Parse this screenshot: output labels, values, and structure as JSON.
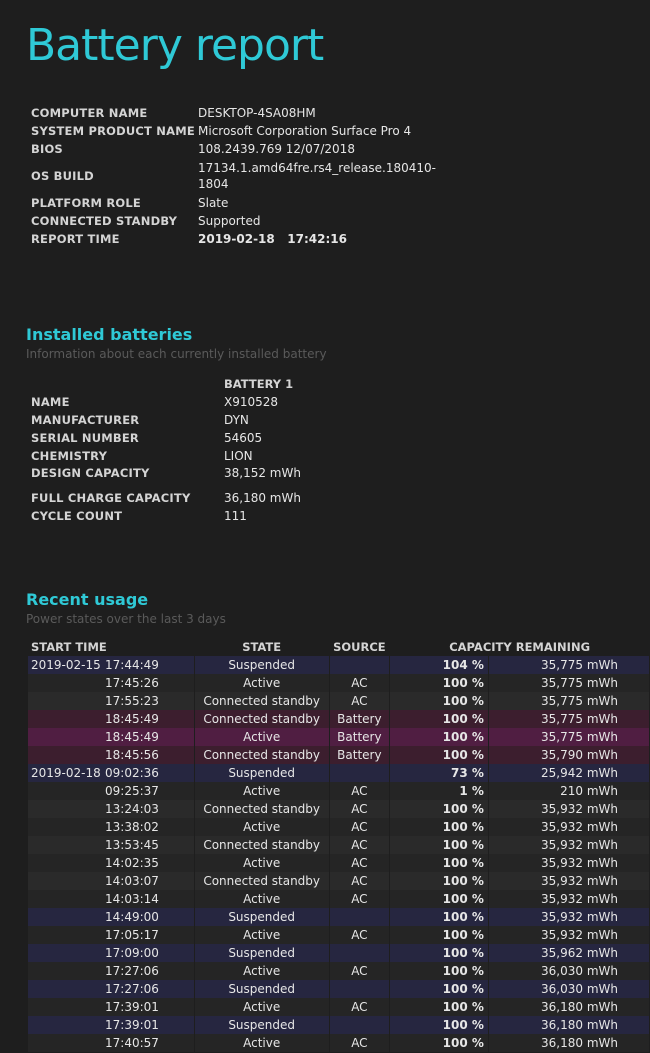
{
  "title": "Battery report",
  "system_info": [
    {
      "label": "COMPUTER NAME",
      "value": "DESKTOP-4SA08HM"
    },
    {
      "label": "SYSTEM PRODUCT NAME",
      "value": "Microsoft Corporation Surface Pro 4"
    },
    {
      "label": "BIOS",
      "value": "108.2439.769 12/07/2018"
    },
    {
      "label": "OS BUILD",
      "value_line1": "17134.1.amd64fre.rs4_release.180410-",
      "value_line2": "1804"
    },
    {
      "label": "PLATFORM ROLE",
      "value": "Slate"
    },
    {
      "label": "CONNECTED STANDBY",
      "value": "Supported"
    },
    {
      "label": "REPORT TIME",
      "value": "2019-02-18   17:42:16"
    }
  ],
  "installed_batteries": {
    "title": "Installed batteries",
    "subtitle": "Information about each currently installed battery",
    "column_header": "BATTERY 1",
    "rows": [
      {
        "label": "NAME",
        "value": "X910528"
      },
      {
        "label": "MANUFACTURER",
        "value": "DYN"
      },
      {
        "label": "SERIAL NUMBER",
        "value": "54605"
      },
      {
        "label": "CHEMISTRY",
        "value": "LION"
      },
      {
        "label": "DESIGN CAPACITY",
        "value": "38,152 mWh"
      },
      {
        "label": "FULL CHARGE CAPACITY",
        "value": "36,180 mWh"
      },
      {
        "label": "CYCLE COUNT",
        "value": "111"
      }
    ]
  },
  "recent_usage": {
    "title": "Recent usage",
    "subtitle": "Power states over the last 3 days",
    "headers": {
      "start_time": "START TIME",
      "state": "STATE",
      "source": "SOURCE",
      "capacity": "CAPACITY REMAINING"
    },
    "rows": [
      {
        "date": "2019-02-15",
        "time": "17:44:49",
        "state": "Suspended",
        "source": "",
        "pct": "104 %",
        "mwh": "35,775 mWh"
      },
      {
        "date": "",
        "time": "17:45:26",
        "state": "Active",
        "source": "AC",
        "pct": "100 %",
        "mwh": "35,775 mWh"
      },
      {
        "date": "",
        "time": "17:55:23",
        "state": "Connected standby",
        "source": "AC",
        "pct": "100 %",
        "mwh": "35,775 mWh"
      },
      {
        "date": "",
        "time": "18:45:49",
        "state": "Connected standby",
        "source": "Battery",
        "pct": "100 %",
        "mwh": "35,775 mWh"
      },
      {
        "date": "",
        "time": "18:45:49",
        "state": "Active",
        "source": "Battery",
        "pct": "100 %",
        "mwh": "35,775 mWh"
      },
      {
        "date": "",
        "time": "18:45:56",
        "state": "Connected standby",
        "source": "Battery",
        "pct": "100 %",
        "mwh": "35,790 mWh"
      },
      {
        "date": "2019-02-18",
        "time": "09:02:36",
        "state": "Suspended",
        "source": "",
        "pct": "73 %",
        "mwh": "25,942 mWh"
      },
      {
        "date": "",
        "time": "09:25:37",
        "state": "Active",
        "source": "AC",
        "pct": "1 %",
        "mwh": "210 mWh"
      },
      {
        "date": "",
        "time": "13:24:03",
        "state": "Connected standby",
        "source": "AC",
        "pct": "100 %",
        "mwh": "35,932 mWh"
      },
      {
        "date": "",
        "time": "13:38:02",
        "state": "Active",
        "source": "AC",
        "pct": "100 %",
        "mwh": "35,932 mWh"
      },
      {
        "date": "",
        "time": "13:53:45",
        "state": "Connected standby",
        "source": "AC",
        "pct": "100 %",
        "mwh": "35,932 mWh"
      },
      {
        "date": "",
        "time": "14:02:35",
        "state": "Active",
        "source": "AC",
        "pct": "100 %",
        "mwh": "35,932 mWh"
      },
      {
        "date": "",
        "time": "14:03:07",
        "state": "Connected standby",
        "source": "AC",
        "pct": "100 %",
        "mwh": "35,932 mWh"
      },
      {
        "date": "",
        "time": "14:03:14",
        "state": "Active",
        "source": "AC",
        "pct": "100 %",
        "mwh": "35,932 mWh"
      },
      {
        "date": "",
        "time": "14:49:00",
        "state": "Suspended",
        "source": "",
        "pct": "100 %",
        "mwh": "35,932 mWh"
      },
      {
        "date": "",
        "time": "17:05:17",
        "state": "Active",
        "source": "AC",
        "pct": "100 %",
        "mwh": "35,932 mWh"
      },
      {
        "date": "",
        "time": "17:09:00",
        "state": "Suspended",
        "source": "",
        "pct": "100 %",
        "mwh": "35,962 mWh"
      },
      {
        "date": "",
        "time": "17:27:06",
        "state": "Active",
        "source": "AC",
        "pct": "100 %",
        "mwh": "36,030 mWh"
      },
      {
        "date": "",
        "time": "17:27:06",
        "state": "Suspended",
        "source": "",
        "pct": "100 %",
        "mwh": "36,030 mWh"
      },
      {
        "date": "",
        "time": "17:39:01",
        "state": "Active",
        "source": "AC",
        "pct": "100 %",
        "mwh": "36,180 mWh"
      },
      {
        "date": "",
        "time": "17:39:01",
        "state": "Suspended",
        "source": "",
        "pct": "100 %",
        "mwh": "36,180 mWh"
      },
      {
        "date": "",
        "time": "17:40:57",
        "state": "Active",
        "source": "AC",
        "pct": "100 %",
        "mwh": "36,180 mWh"
      }
    ]
  },
  "colors": {
    "accent": "#2fc9d6",
    "background": "#1e1e1e",
    "row_active": "#252525",
    "row_standby": "#2a2a2a",
    "row_suspended": "#262640",
    "row_battery": "#3c1e2e",
    "row_battery_active": "#501e42"
  }
}
